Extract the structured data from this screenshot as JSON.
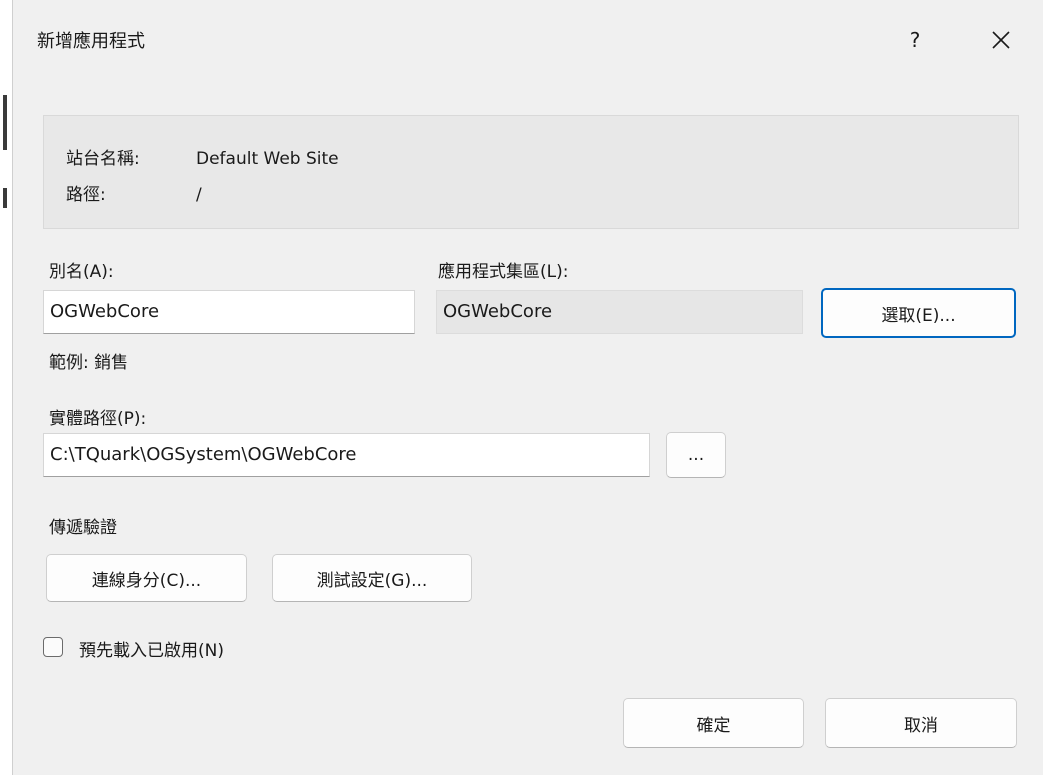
{
  "dialog": {
    "title": "新增應用程式",
    "help_label": "?"
  },
  "info": {
    "site_name_label": "站台名稱:",
    "site_name_value": "Default Web Site",
    "path_label": "路徑:",
    "path_value": "/"
  },
  "alias": {
    "label": "別名(A):",
    "value": "OGWebCore",
    "example": "範例: 銷售"
  },
  "app_pool": {
    "label": "應用程式集區(L):",
    "value": "OGWebCore",
    "select_button": "選取(E)..."
  },
  "physical_path": {
    "label": "實體路徑(P):",
    "value": "C:\\TQuark\\OGSystem\\OGWebCore",
    "browse_button": "..."
  },
  "pass_through_auth": {
    "label": "傳遞驗證",
    "connect_as_button": "連線身分(C)...",
    "test_settings_button": "測試設定(G)..."
  },
  "preload": {
    "label": "預先載入已啟用(N)",
    "checked": false
  },
  "footer": {
    "ok_button": "確定",
    "cancel_button": "取消"
  }
}
